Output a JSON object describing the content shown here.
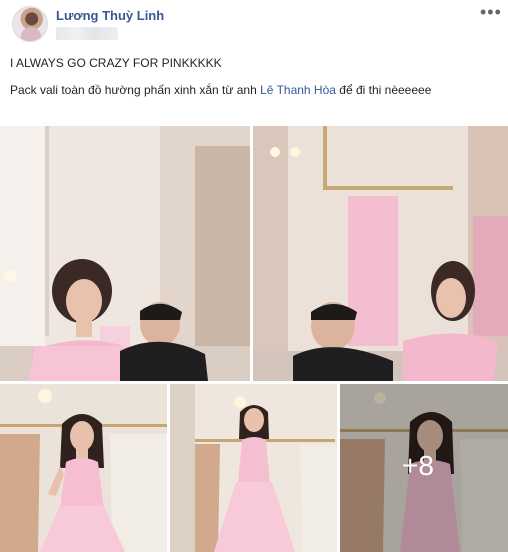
{
  "post": {
    "author": "Lương Thuỳ Linh",
    "line1": "I ALWAYS GO CRAZY FOR PINKKKKK",
    "line2_before": "Pack vali toàn đồ hường phấn xinh xắn từ anh ",
    "line2_link": "Lê Thanh Hòa",
    "line2_after": " để đi thi nèeeeee",
    "more_menu": "•••",
    "more_photos": "+8"
  },
  "colors": {
    "author_link": "#365899",
    "dress_pink": "#f4b8cc",
    "background": "#ffffff"
  }
}
